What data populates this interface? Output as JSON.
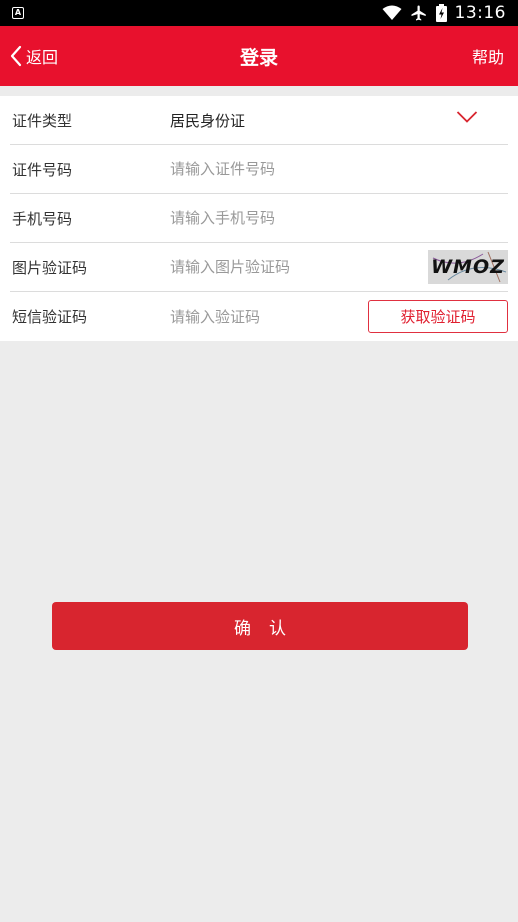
{
  "status_bar": {
    "time": "13:16",
    "icons": [
      "a-notification-icon",
      "wifi-icon",
      "airplane-icon",
      "battery-charging-icon"
    ]
  },
  "app_bar": {
    "back_label": "返回",
    "title": "登录",
    "help_label": "帮助",
    "background_color": "#e8112d"
  },
  "form": {
    "id_type": {
      "label": "证件类型",
      "value": "居民身份证"
    },
    "id_number": {
      "label": "证件号码",
      "placeholder": "请输入证件号码"
    },
    "phone": {
      "label": "手机号码",
      "placeholder": "请输入手机号码"
    },
    "image_code": {
      "label": "图片验证码",
      "placeholder": "请输入图片验证码",
      "captcha_text": "WMOZ"
    },
    "sms_code": {
      "label": "短信验证码",
      "placeholder": "请输入验证码",
      "button_label": "获取验证码"
    }
  },
  "confirm_label": "确认",
  "accent_color": "#d8252f"
}
